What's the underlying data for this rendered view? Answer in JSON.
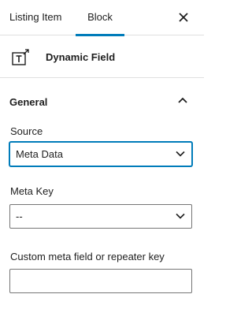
{
  "tabs": {
    "listing_label": "Listing Item",
    "block_label": "Block"
  },
  "close_icon": "close-icon",
  "block": {
    "title": "Dynamic Field",
    "icon": "dynamic-field-icon"
  },
  "panel": {
    "title": "General",
    "source": {
      "label": "Source",
      "value": "Meta Data"
    },
    "meta_key": {
      "label": "Meta Key",
      "value": "--"
    },
    "custom_key": {
      "label": "Custom meta field or repeater key",
      "value": ""
    }
  },
  "colors": {
    "accent": "#007cba",
    "border": "#757575",
    "divider": "#e0e0e0"
  }
}
